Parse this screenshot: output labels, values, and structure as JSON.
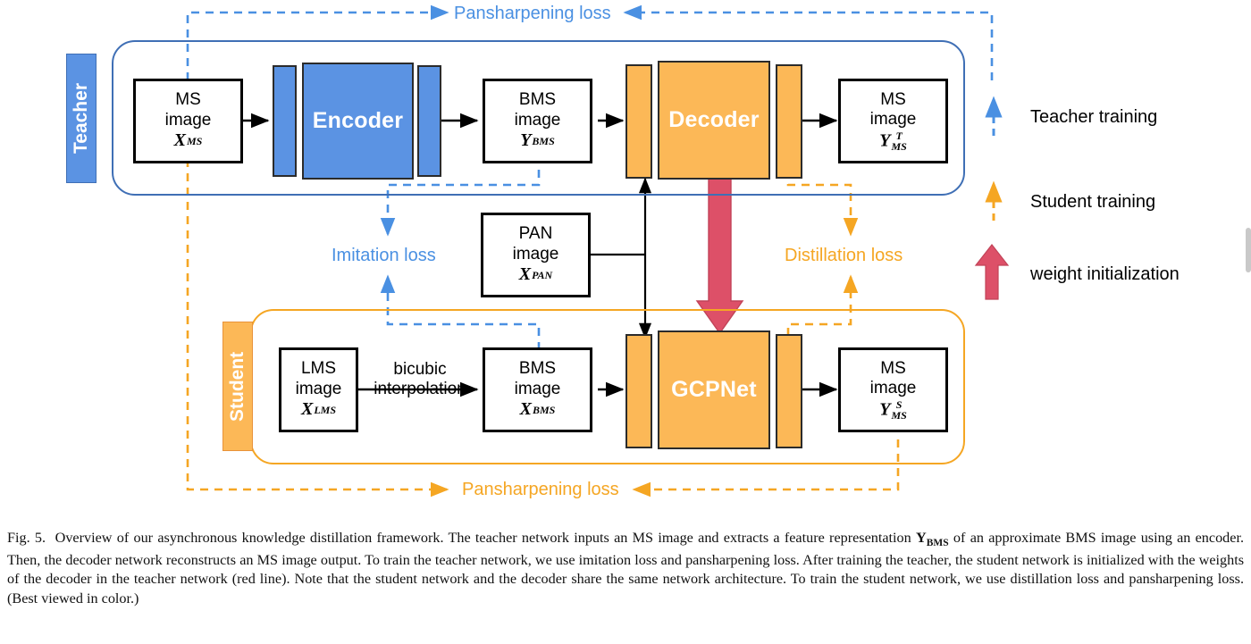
{
  "figure": {
    "teacher_tab": "Teacher",
    "student_tab": "Student"
  },
  "nodes": {
    "ms_input": {
      "line1": "MS",
      "line2": "image",
      "sym_base": "X",
      "sym_sub": "MS",
      "sym_sup": ""
    },
    "encoder": {
      "label": "Encoder"
    },
    "bms_teacher": {
      "line1": "BMS",
      "line2": "image",
      "sym_base": "Y",
      "sym_sub": "BMS",
      "sym_sup": ""
    },
    "decoder": {
      "label": "Decoder"
    },
    "ms_teacher_out": {
      "line1": "MS",
      "line2": "image",
      "sym_base": "Y",
      "sym_sub": "MS",
      "sym_sup": "T"
    },
    "pan": {
      "line1": "PAN",
      "line2": "image",
      "sym_base": "X",
      "sym_sub": "PAN",
      "sym_sup": ""
    },
    "lms": {
      "line1": "LMS",
      "line2": "image",
      "sym_base": "X",
      "sym_sub": "LMS",
      "sym_sup": ""
    },
    "bms_student": {
      "line1": "BMS",
      "line2": "image",
      "sym_base": "X",
      "sym_sub": "BMS",
      "sym_sup": ""
    },
    "gcpnet": {
      "label": "GCPNet"
    },
    "ms_student_out": {
      "line1": "MS",
      "line2": "image",
      "sym_base": "Y",
      "sym_sub": "MS",
      "sym_sup": "S"
    }
  },
  "edge_labels": {
    "bicubic_line1": "bicubic",
    "bicubic_line2": "interpolation"
  },
  "losses": {
    "pansharpening_top": "Pansharpening loss",
    "pansharpening_bottom": "Pansharpening loss",
    "imitation": "Imitation loss",
    "distillation": "Distillation loss"
  },
  "legend": {
    "teacher_training": "Teacher training",
    "student_training": "Student training",
    "weight_initialization": "weight initialization"
  },
  "colors": {
    "blue": "#5B93E3",
    "blue_dark": "#3f6fb5",
    "blue_loss": "#4a90e2",
    "orange": "#FCB857",
    "orange_line": "#F5A623",
    "red": "#DD5068",
    "black": "#000000"
  },
  "caption": {
    "figure_number": "Fig. 5.",
    "text_part1": "Overview of our asynchronous knowledge distillation framework. The teacher network inputs an MS image and extracts a feature representation ",
    "symbol_y": "Y",
    "symbol_y_sub": "BMS",
    "text_part2": " of an approximate BMS image using an encoder. Then, the decoder network reconstructs an MS image output. To train the teacher network, we use imitation loss and pansharpening loss. After training the teacher, the student network is initialized with the weights of the decoder in the teacher network (red line). Note that the student network and the decoder share the same network architecture. To train the student network, we use distillation loss and pansharpening loss. (Best viewed in color.)"
  }
}
